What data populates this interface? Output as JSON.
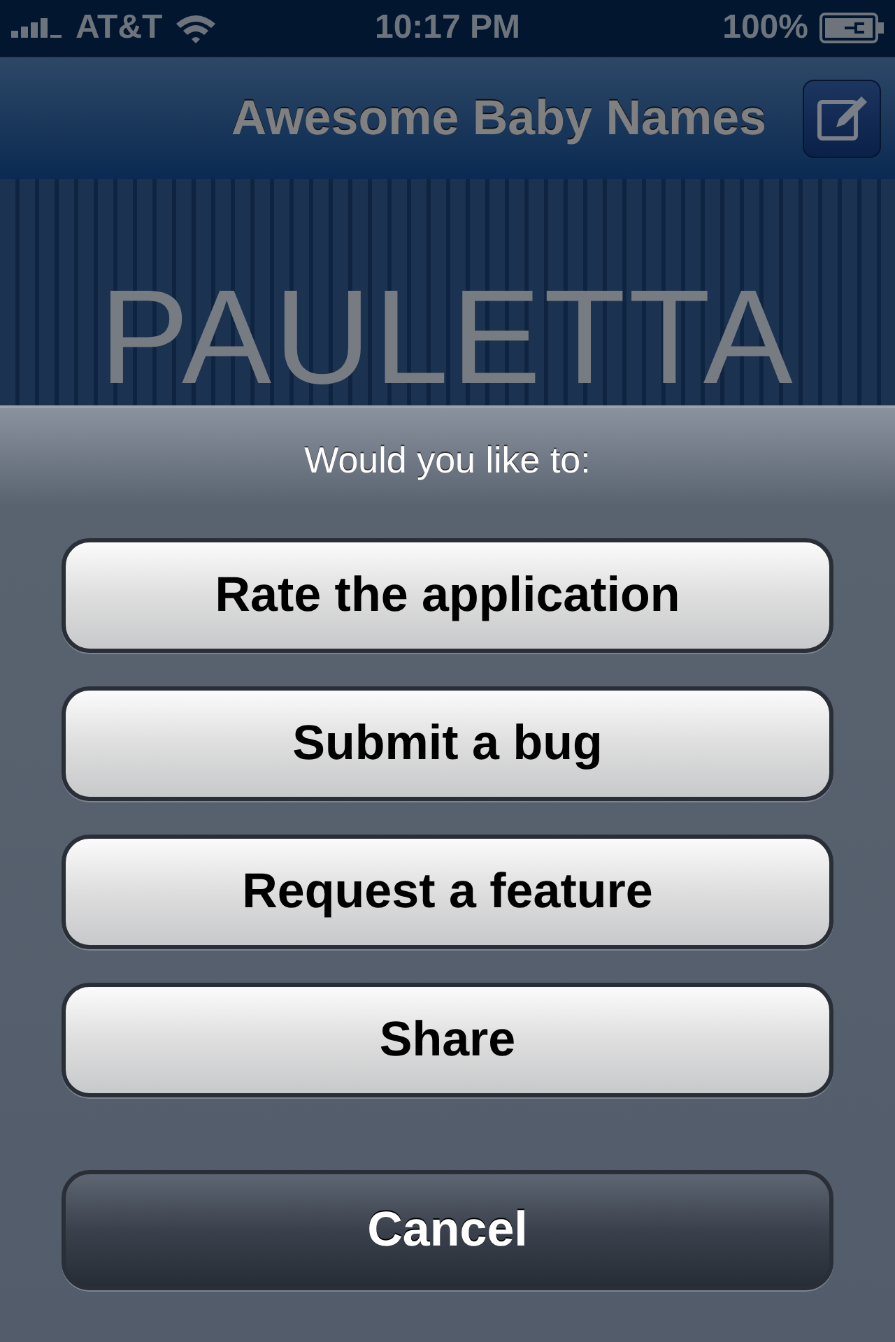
{
  "status_bar": {
    "carrier": "AT&T",
    "time": "10:17 PM",
    "battery": "100%"
  },
  "nav_bar": {
    "title": "Awesome Baby Names"
  },
  "name_display": {
    "name": "PAULETTA"
  },
  "action_sheet": {
    "title": "Would you like to:",
    "buttons": [
      {
        "label": "Rate the application",
        "kind": "default"
      },
      {
        "label": "Submit a bug",
        "kind": "default"
      },
      {
        "label": "Request a feature",
        "kind": "default"
      },
      {
        "label": "Share",
        "kind": "default"
      },
      {
        "label": "Cancel",
        "kind": "cancel"
      }
    ]
  }
}
